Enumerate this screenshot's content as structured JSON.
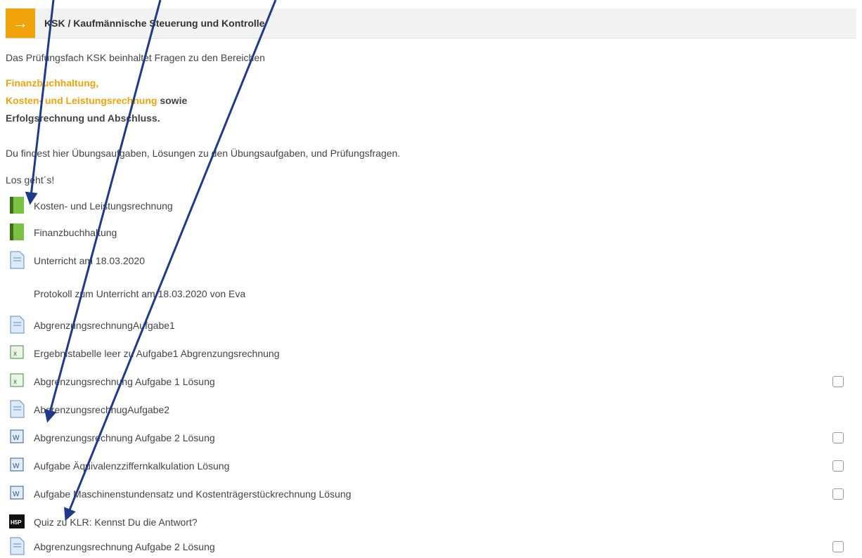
{
  "section": {
    "title": "KSK / Kaufmännische Steuerung und Kontrolle"
  },
  "intro": {
    "line1": "Das Prüfungsfach KSK beinhaltet Fragen zu den Bereichen",
    "topic1": "Finanzbuchhaltung",
    "topic1_suffix": ",",
    "topic2": "Kosten- und Leistungsrechnung",
    "topic2_suffix": " sowie",
    "topic3": "Erfolgsrechnung und Abschluss.",
    "line2": "Du findest hier Übungsaufgaben, Lösungen zu den Übungsaufgaben, und Prüfungsfragen.",
    "line3": "Los geht´s!"
  },
  "activities": [
    {
      "label": "Kosten- und Leistungsrechnung",
      "icon": "book-icon",
      "checkbox": false
    },
    {
      "label": "Finanzbuchhaltung",
      "icon": "book-icon",
      "checkbox": false
    },
    {
      "label": "Unterricht am 18.03.2020",
      "icon": "page-icon",
      "checkbox": false
    },
    {
      "label": "AbgrenzungsrechnungAufgabe1",
      "icon": "page-icon",
      "checkbox": false
    },
    {
      "label": "Ergebnistabelle leer zu Aufgabe1 Abgrenzungsrechnung",
      "icon": "spreadsheet-icon",
      "checkbox": false
    },
    {
      "label": "Abgrenzungsrechnung Aufgabe 1 Lösung",
      "icon": "spreadsheet-icon",
      "checkbox": true
    },
    {
      "label": "AbgrenzungsrechnugAufgabe2",
      "icon": "page-icon",
      "checkbox": false
    },
    {
      "label": "Abgrenzungsrechnung Aufgabe 2 Lösung",
      "icon": "word-icon",
      "checkbox": true
    },
    {
      "label": "Aufgabe Äquivalenzziffernkalkulation Lösung",
      "icon": "word-icon",
      "checkbox": true
    },
    {
      "label": "Aufgabe Maschinenstundensatz und Kostenträgerstückrechnung Lösung",
      "icon": "word-icon",
      "checkbox": true
    },
    {
      "label": "Quiz zu KLR: Kennst Du die Antwort?",
      "icon": "h5p-icon",
      "checkbox": false
    },
    {
      "label": "Abgrenzungsrechnung Aufgabe 2 Lösung",
      "icon": "page-icon",
      "checkbox": true
    }
  ],
  "description": "Protokoll zum Unterricht am 18.03.2020 von Eva",
  "colors": {
    "accent": "#f0a30a",
    "arrow": "#1f3a8a",
    "book": "#7cc242"
  }
}
